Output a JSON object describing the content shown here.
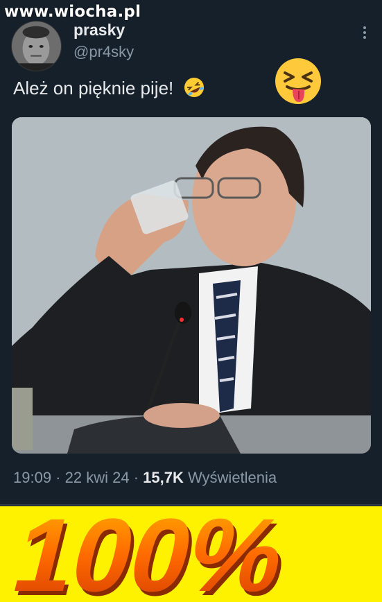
{
  "watermark": {
    "text": "www.wiocha.pl"
  },
  "user": {
    "display_name": "prasky",
    "handle": "@pr4sky"
  },
  "tweet": {
    "text": "Ależ on pięknie pije!",
    "emoji_inline": "rolling-on-floor-laughing",
    "emoji_big": "squinting-face-with-tongue"
  },
  "meta": {
    "time": "19:09",
    "sep1": " · ",
    "date": "22 kwi 24",
    "sep2": " · ",
    "views_count": "15,7K",
    "views_label": " Wyświetlenia"
  },
  "banner": {
    "text": "100%"
  },
  "colors": {
    "background": "#15202b",
    "text": "#e7e9ea",
    "muted": "#8b98a5",
    "banner_bg": "#fff200",
    "banner_text": "#ff6a00"
  }
}
